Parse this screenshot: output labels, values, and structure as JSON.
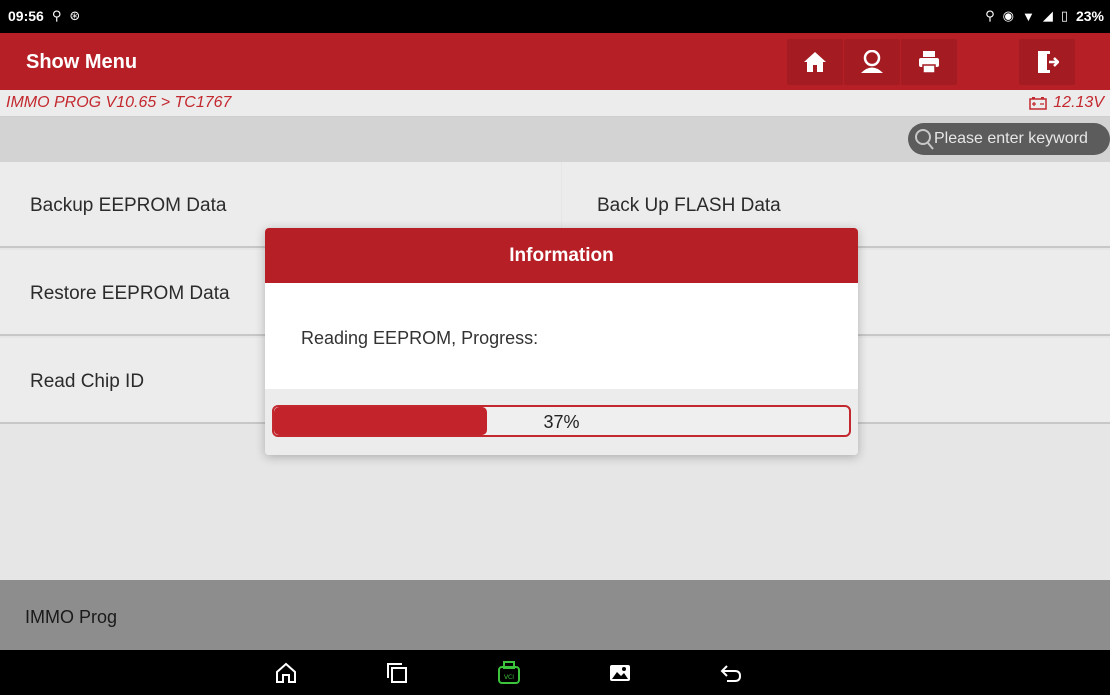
{
  "status_bar": {
    "time": "09:56",
    "battery": "23%"
  },
  "header": {
    "title": "Show Menu",
    "buttons": [
      "home-icon",
      "user-icon",
      "print-icon",
      "exit-icon"
    ]
  },
  "breadcrumb": {
    "path": "IMMO PROG V10.65 > TC1767",
    "voltage": "12.13V"
  },
  "search": {
    "placeholder": "Please enter keyword"
  },
  "menu": {
    "items": [
      {
        "label": "Backup EEPROM Data"
      },
      {
        "label": "Back Up FLASH Data"
      },
      {
        "label": "Restore EEPROM Data"
      },
      {
        "label": "Read Chip ID"
      }
    ]
  },
  "footer": {
    "label": "IMMO Prog"
  },
  "dialog": {
    "title": "Information",
    "message": "Reading EEPROM, Progress:",
    "progress_fraction": 0.37,
    "progress_text": "37%"
  },
  "navbar": {
    "icons": [
      "home-icon",
      "recent-apps-icon",
      "vci-icon",
      "screenshot-icon",
      "back-icon"
    ]
  },
  "colors": {
    "brand_red": "#b71f26",
    "crumb_red": "#c3282e",
    "vci_green": "#3cc43c"
  }
}
